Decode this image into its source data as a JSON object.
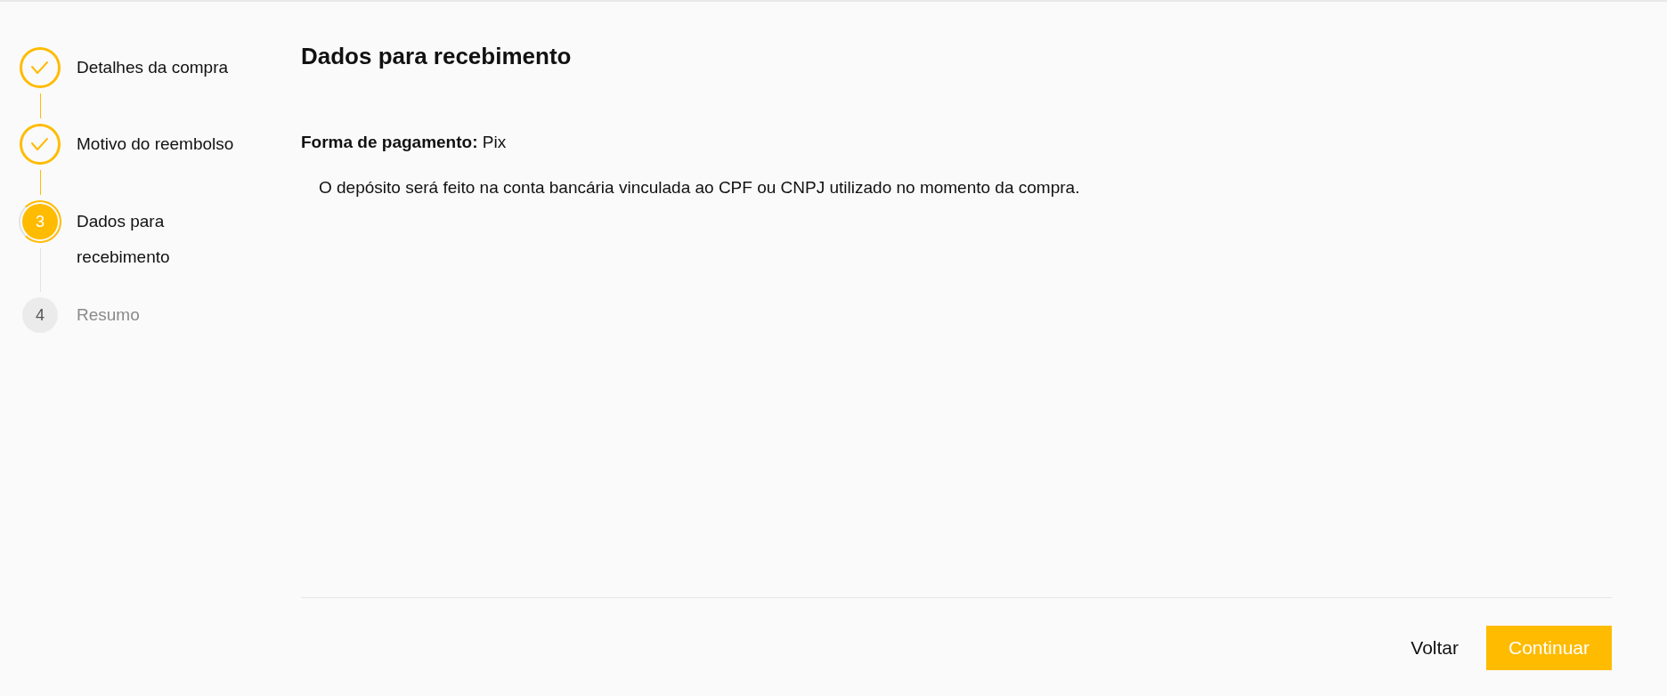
{
  "stepper": {
    "steps": [
      {
        "kind": "done",
        "label": "Detalhes da compra"
      },
      {
        "kind": "done",
        "label": "Motivo do reembolso"
      },
      {
        "kind": "current",
        "number": "3",
        "label": "Dados para recebimento"
      },
      {
        "kind": "pending",
        "number": "4",
        "label": "Resumo"
      }
    ]
  },
  "content": {
    "title": "Dados para recebimento",
    "payment_method": "**Forma de pagamento:** Pix",
    "description": "O depósito será feito na conta bancária vinculada ao CPF ou CNPJ utilizado no momento da compra."
  },
  "footer": {
    "buttons": [
      {
        "kind": "secondary",
        "label": "Voltar"
      },
      {
        "kind": "primary",
        "label": "Continuar"
      }
    ]
  }
}
